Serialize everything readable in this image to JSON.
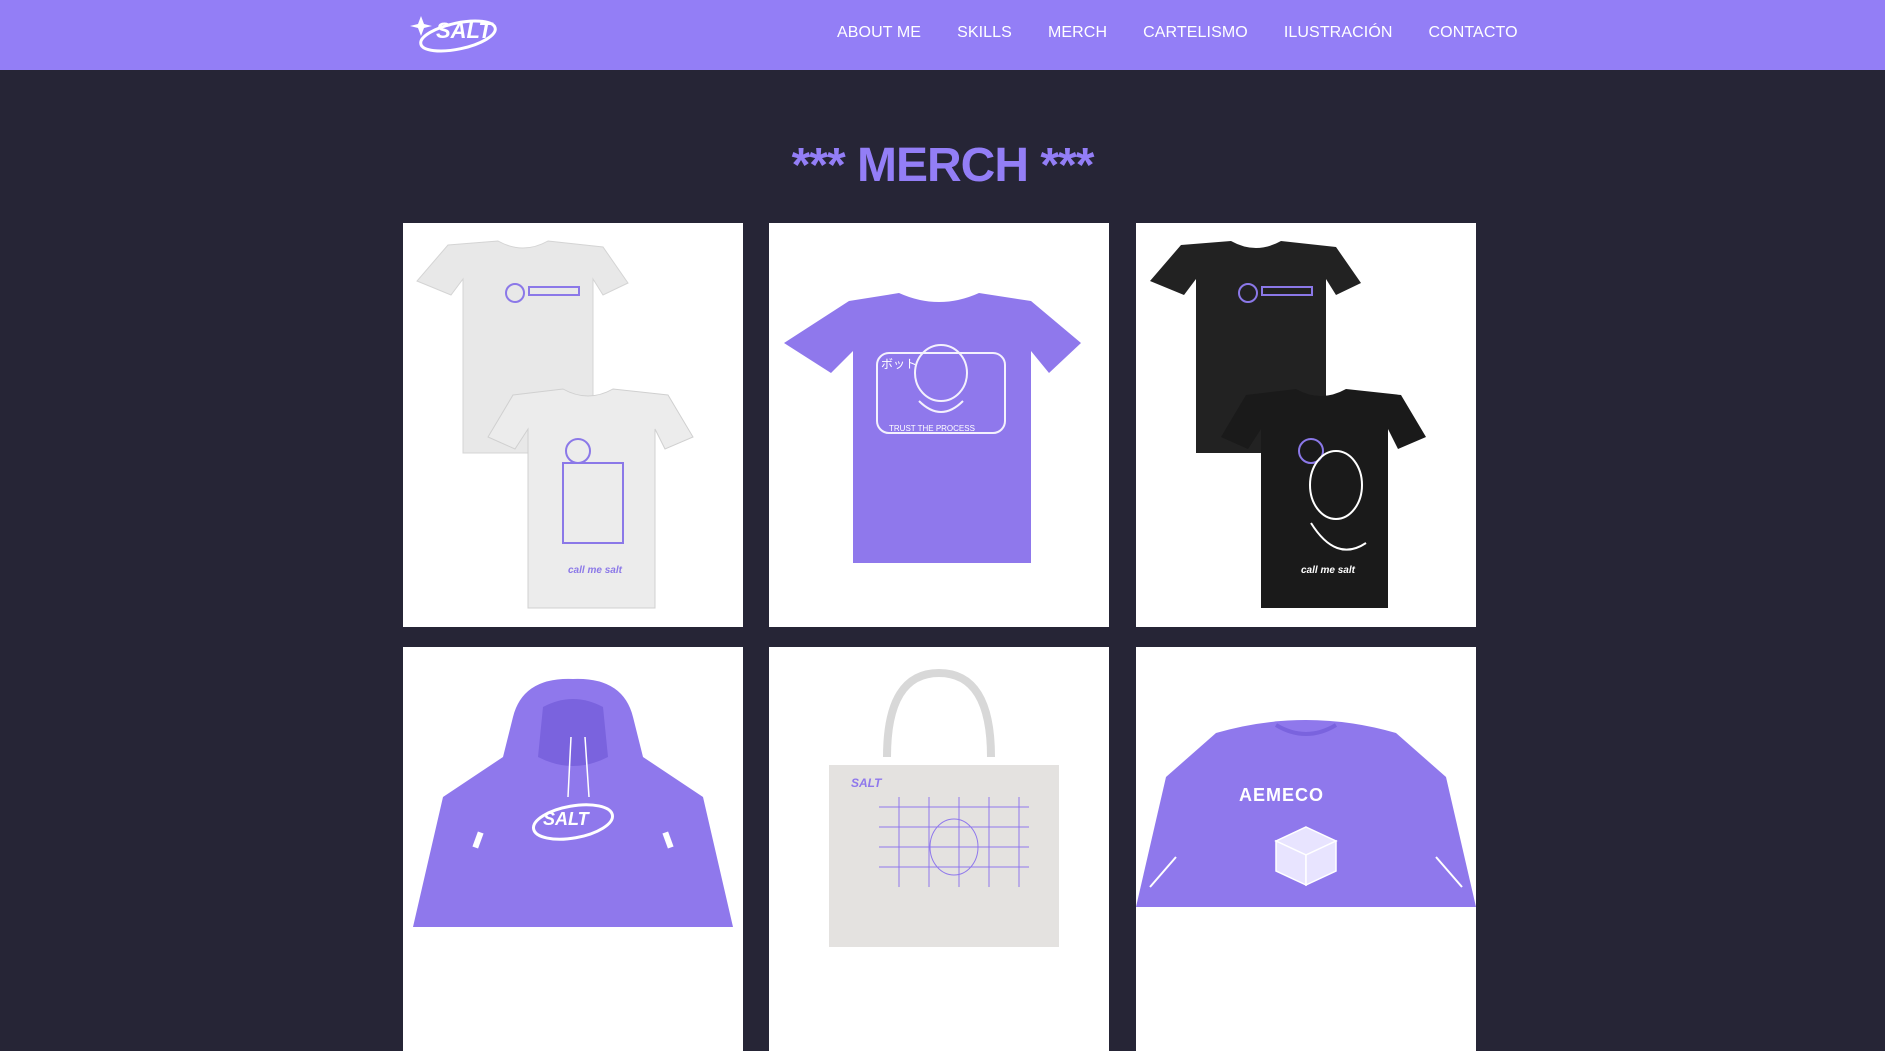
{
  "nav": {
    "logo_alt": "SALT",
    "links": [
      "ABOUT ME",
      "SKILLS",
      "MERCH",
      "CARTELISMO",
      "ILUSTRACIÓN",
      "CONTACTO"
    ]
  },
  "main": {
    "title": "*** MERCH ***"
  },
  "products": [
    {
      "name": "white-tshirt-front-back",
      "print_text": "call me salt"
    },
    {
      "name": "purple-tshirt",
      "print_text": "TRUST THE PROCESS",
      "print_jp": "ボット"
    },
    {
      "name": "black-tshirt-front-back",
      "print_text": "call me salt"
    },
    {
      "name": "purple-hoodie",
      "print_text": "SALT"
    },
    {
      "name": "tote-bag",
      "print_text": "SALT"
    },
    {
      "name": "purple-sweatshirt",
      "print_text": "AEMECO"
    }
  ],
  "colors": {
    "accent": "#937ef6",
    "background": "#262536",
    "card": "#ffffff"
  }
}
